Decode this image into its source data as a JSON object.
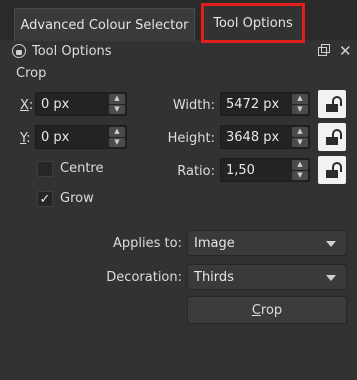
{
  "tabs": [
    {
      "label": "Advanced Colour Selector"
    },
    {
      "label": "Tool Options"
    }
  ],
  "panel": {
    "title": "Tool Options"
  },
  "crop": {
    "section_label": "Crop",
    "x": {
      "label_key": "X",
      "label_rest": ":",
      "value": "0 px"
    },
    "y": {
      "label_key": "Y",
      "label_rest": ":",
      "value": "0 px"
    },
    "width": {
      "label": "Width:",
      "value": "5472 px"
    },
    "height": {
      "label": "Height:",
      "value": "3648 px"
    },
    "ratio": {
      "label": "Ratio:",
      "value": "1,50"
    },
    "centre": {
      "label": "Centre",
      "checked": false
    },
    "grow": {
      "label": "Grow",
      "checked": true
    },
    "applies_to": {
      "label": "Applies to:",
      "value": "Image"
    },
    "decoration": {
      "label": "Decoration:",
      "value": "Thirds"
    },
    "button_key": "C",
    "button_rest": "rop"
  },
  "icons": {
    "panel_lock": "lock-icon",
    "float": "float-panel-icon",
    "close": "close-icon",
    "spin_up": "▲",
    "spin_down": "▼",
    "check": "✓",
    "close_glyph": "✕"
  }
}
